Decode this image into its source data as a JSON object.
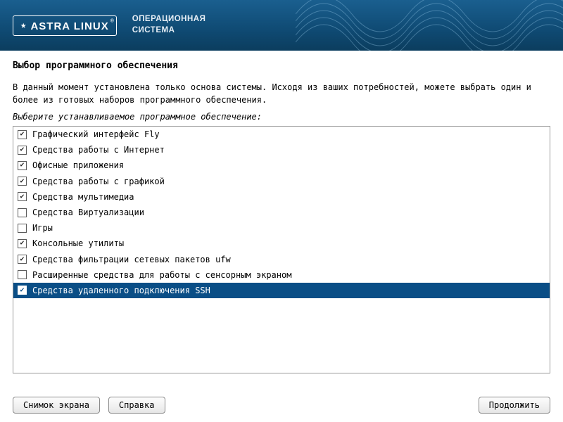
{
  "header": {
    "logo_text": "ASTRA LINUX",
    "title_line1": "ОПЕРАЦИОННАЯ",
    "title_line2": "СИСТЕМА"
  },
  "page": {
    "title": "Выбор программного обеспечения",
    "description": "В данный момент установлена только основа системы. Исходя из ваших потребностей, можете выбрать один и более из готовых наборов программного обеспечения.",
    "instruction": "Выберите устанавливаемое программное обеспечение:"
  },
  "software_list": [
    {
      "label": "Графический интерфейс Fly",
      "checked": true,
      "selected": false
    },
    {
      "label": "Средства работы с Интернет",
      "checked": true,
      "selected": false
    },
    {
      "label": "Офисные приложения",
      "checked": true,
      "selected": false
    },
    {
      "label": "Средства работы с графикой",
      "checked": true,
      "selected": false
    },
    {
      "label": "Средства мультимедиа",
      "checked": true,
      "selected": false
    },
    {
      "label": "Средства Виртуализации",
      "checked": false,
      "selected": false
    },
    {
      "label": "Игры",
      "checked": false,
      "selected": false
    },
    {
      "label": "Консольные утилиты",
      "checked": true,
      "selected": false
    },
    {
      "label": "Средства фильтрации сетевых пакетов ufw",
      "checked": true,
      "selected": false
    },
    {
      "label": "Расширенные средства для работы с сенсорным экраном",
      "checked": false,
      "selected": false
    },
    {
      "label": "Средства удаленного подключения SSH",
      "checked": true,
      "selected": true
    }
  ],
  "buttons": {
    "screenshot": "Снимок экрана",
    "help": "Справка",
    "continue": "Продолжить"
  },
  "colors": {
    "selection_bg": "#0a4e86",
    "header_grad_top": "#1a5f8f",
    "header_grad_bottom": "#0b3d5e"
  }
}
